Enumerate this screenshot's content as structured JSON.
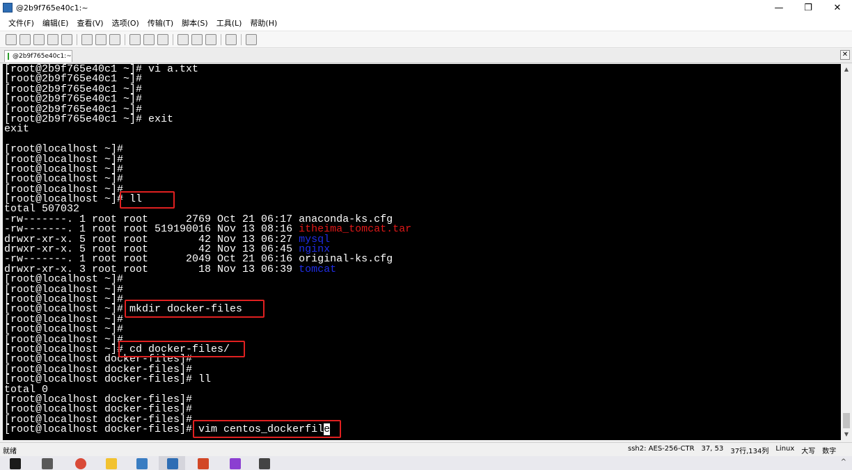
{
  "window": {
    "title": "@2b9f765e40c1:~",
    "min_glyph": "—",
    "restore_glyph": "❐",
    "close_glyph": "✕"
  },
  "menu": [
    "文件(F)",
    "编辑(E)",
    "查看(V)",
    "选项(O)",
    "传输(T)",
    "脚本(S)",
    "工具(L)",
    "帮助(H)"
  ],
  "tab": {
    "label": "@2b9f765e40c1:~",
    "close_glyph": "✕"
  },
  "terminal": {
    "lines": [
      "[root@2b9f765e40c1 ~]# vi a.txt",
      "[root@2b9f765e40c1 ~]#",
      "[root@2b9f765e40c1 ~]#",
      "[root@2b9f765e40c1 ~]#",
      "[root@2b9f765e40c1 ~]#",
      "[root@2b9f765e40c1 ~]# exit",
      "exit",
      "",
      "[root@localhost ~]#",
      "[root@localhost ~]#",
      "[root@localhost ~]#",
      "[root@localhost ~]#",
      "[root@localhost ~]#",
      "[root@localhost ~]# ll",
      "total 507032",
      "-rw-------. 1 root root      2769 Oct 21 06:17 anaconda-ks.cfg",
      "-rw-------. 1 root root 519190016 Nov 13 08:16 itheima_tomcat.tar",
      "drwxr-xr-x. 5 root root        42 Nov 13 06:27 mysql",
      "drwxr-xr-x. 5 root root        42 Nov 13 06:45 nginx",
      "-rw-------. 1 root root      2049 Oct 21 06:16 original-ks.cfg",
      "drwxr-xr-x. 3 root root        18 Nov 13 06:39 tomcat",
      "[root@localhost ~]#",
      "[root@localhost ~]#",
      "[root@localhost ~]#",
      "[root@localhost ~]# mkdir docker-files",
      "[root@localhost ~]#",
      "[root@localhost ~]#",
      "[root@localhost ~]#",
      "[root@localhost ~]# cd docker-files/",
      "[root@localhost docker-files]#",
      "[root@localhost docker-files]#",
      "[root@localhost docker-files]# ll",
      "total 0",
      "[root@localhost docker-files]#",
      "[root@localhost docker-files]#",
      "[root@localhost docker-files]#",
      "[root@localhost docker-files]# vim centos_dockerfil"
    ],
    "ls_entries": [
      {
        "line": 16,
        "name": "itheima_tomcat.tar",
        "color": "#e01818"
      },
      {
        "line": 17,
        "name": "mysql",
        "color": "#1f2de6"
      },
      {
        "line": 18,
        "name": "nginx",
        "color": "#1f2de6"
      },
      {
        "line": 20,
        "name": "tomcat",
        "color": "#1f2de6"
      }
    ],
    "cursor_char": "e",
    "highlight_color": "#e02020"
  },
  "status": {
    "ready": "就绪",
    "session": "ssh2: AES-256-CTR",
    "position": "37, 53",
    "size": "37行,134列",
    "os": "Linux",
    "caps": "大写",
    "num": "数字"
  }
}
